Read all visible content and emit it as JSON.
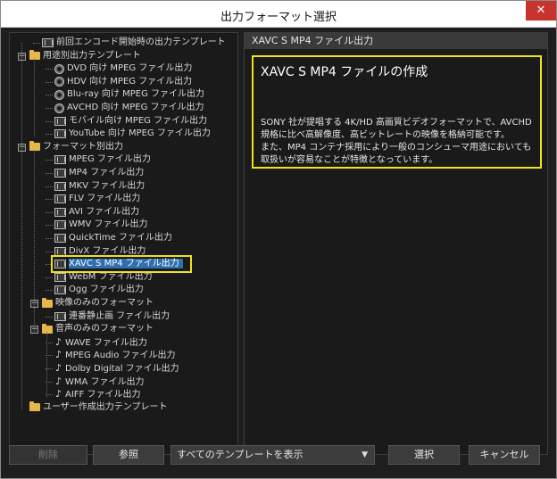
{
  "window": {
    "title": "出力フォーマット選択",
    "close_glyph": "✕"
  },
  "tree": {
    "items": [
      {
        "label": "前回エンコード開始時の出力テンプレート",
        "icon": "film-icon"
      },
      {
        "label": "用途別出力テンプレート",
        "icon": "folder-icon",
        "toggle": "−"
      },
      {
        "label": "DVD 向け MPEG ファイル出力",
        "icon": "disc-icon"
      },
      {
        "label": "HDV 向け MPEG ファイル出力",
        "icon": "disc-icon"
      },
      {
        "label": "Blu-ray 向け MPEG ファイル出力",
        "icon": "disc-icon"
      },
      {
        "label": "AVCHD 向け MPEG ファイル出力",
        "icon": "disc-icon"
      },
      {
        "label": "モバイル向け MPEG ファイル出力",
        "icon": "film-icon"
      },
      {
        "label": "YouTube 向け MPEG ファイル出力",
        "icon": "film-icon"
      },
      {
        "label": "フォーマット別出力",
        "icon": "folder-icon",
        "toggle": "−"
      },
      {
        "label": "MPEG ファイル出力",
        "icon": "film-icon"
      },
      {
        "label": "MP4 ファイル出力",
        "icon": "film-icon"
      },
      {
        "label": "MKV ファイル出力",
        "icon": "film-icon"
      },
      {
        "label": "FLV ファイル出力",
        "icon": "film-icon"
      },
      {
        "label": "AVI ファイル出力",
        "icon": "film-icon"
      },
      {
        "label": "WMV ファイル出力",
        "icon": "film-icon"
      },
      {
        "label": "QuickTime ファイル出力",
        "icon": "film-icon"
      },
      {
        "label": "DivX ファイル出力",
        "icon": "film-icon"
      },
      {
        "label": "XAVC S MP4 ファイル出力",
        "icon": "film-icon",
        "selected": true
      },
      {
        "label": "WebM ファイル出力",
        "icon": "film-icon"
      },
      {
        "label": "Ogg ファイル出力",
        "icon": "film-icon"
      },
      {
        "label": "映像のみのフォーマット",
        "icon": "folder-icon",
        "toggle": "−"
      },
      {
        "label": "連番静止画 ファイル出力",
        "icon": "image-icon"
      },
      {
        "label": "音声のみのフォーマット",
        "icon": "folder-icon",
        "toggle": "−"
      },
      {
        "label": "WAVE ファイル出力",
        "icon": "note-icon"
      },
      {
        "label": "MPEG Audio ファイル出力",
        "icon": "note-icon"
      },
      {
        "label": "Dolby Digital ファイル出力",
        "icon": "note-icon"
      },
      {
        "label": "WMA ファイル出力",
        "icon": "note-icon"
      },
      {
        "label": "AIFF ファイル出力",
        "icon": "note-icon"
      },
      {
        "label": "ユーザー作成出力テンプレート",
        "icon": "folder-icon"
      }
    ]
  },
  "info": {
    "header": "XAVC S MP4 ファイル出力",
    "title": "XAVC S MP4 ファイルの作成",
    "body": "SONY 社が提唱する 4K/HD 高画質ビデオフォーマットで、AVCHD 規格に比べ高解像度、高ビットレートの映像を格納可能です。\nまた、MP4 コンテナ採用により一般のコンシューマ用途においても取扱いが容易なことが特徴となっています。"
  },
  "buttons": {
    "delete": "削除",
    "browse": "参照",
    "filter_value": "すべてのテンプレートを表示",
    "select": "選択",
    "cancel": "キャンセル"
  },
  "colors": {
    "highlight": "#f2e21b",
    "selection": "#2f6fb0",
    "close": "#c7342e"
  }
}
